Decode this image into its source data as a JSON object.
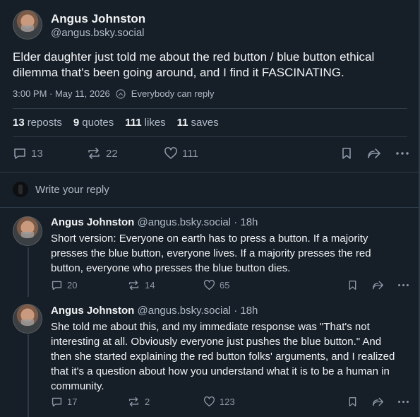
{
  "post": {
    "author_name": "Angus Johnston",
    "author_handle": "@angus.bsky.social",
    "text": "Elder daughter just told me about the red button / blue button ethical dilemma that's been going around, and I find it FASCINATING.",
    "timestamp": "3:00 PM · May 11, 2026",
    "audience": "Everybody can reply",
    "stats": {
      "reposts_count": "13",
      "reposts_label": "reposts",
      "quotes_count": "9",
      "quotes_label": "quotes",
      "likes_count": "111",
      "likes_label": "likes",
      "saves_count": "11",
      "saves_label": "saves"
    },
    "actions": {
      "reply_count": "13",
      "repost_count": "22",
      "like_count": "111"
    }
  },
  "reply_box": {
    "placeholder": "Write your reply"
  },
  "replies": [
    {
      "author_name": "Angus Johnston",
      "author_handle": "@angus.bsky.social",
      "age": "· 18h",
      "text": "Short version: Everyone on earth has to press a button. If a majority presses the blue button, everyone lives. If a majority presses the red button, everyone who presses the blue button dies.",
      "reply_count": "20",
      "repost_count": "14",
      "like_count": "65"
    },
    {
      "author_name": "Angus Johnston",
      "author_handle": "@angus.bsky.social",
      "age": "· 18h",
      "text": "She told me about this, and my immediate response was \"That's not interesting at all. Obviously everyone just pushes the blue button.\" And then she started explaining the red button folks' arguments, and I realized that it's a question about how you understand what it is to be a human in community.",
      "reply_count": "17",
      "repost_count": "2",
      "like_count": "123"
    }
  ],
  "colors": {
    "background": "#161e27",
    "text": "#f1f3f5",
    "muted": "#aebbc9",
    "icon": "#8b98a8",
    "divider": "#2e3b49"
  },
  "icons": [
    "globe-icon",
    "reply-icon",
    "repost-icon",
    "like-icon",
    "bookmark-icon",
    "share-icon",
    "more-icon"
  ]
}
